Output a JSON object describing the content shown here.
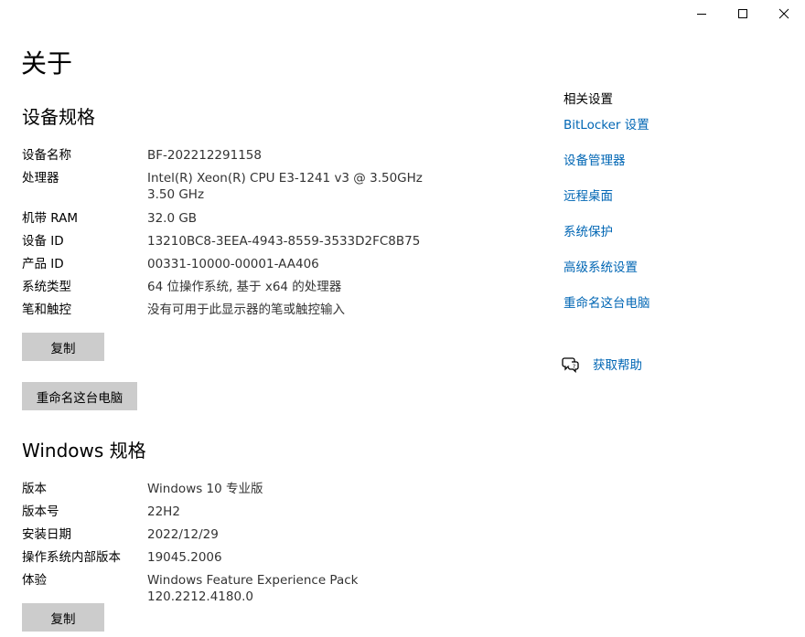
{
  "window": {
    "controls": {
      "minimize_icon": "minimize-icon",
      "maximize_icon": "maximize-icon",
      "close_icon": "close-icon"
    }
  },
  "page": {
    "title": "关于"
  },
  "device_specs": {
    "title": "设备规格",
    "rows": [
      {
        "label": "设备名称",
        "value": "BF-202212291158"
      },
      {
        "label": "处理器",
        "value": "Intel(R) Xeon(R) CPU E3-1241 v3 @ 3.50GHz   3.50 GHz"
      },
      {
        "label": "机带 RAM",
        "value": "32.0 GB"
      },
      {
        "label": "设备 ID",
        "value": "13210BC8-3EEA-4943-8559-3533D2FC8B75"
      },
      {
        "label": "产品 ID",
        "value": "00331-10000-00001-AA406"
      },
      {
        "label": "系统类型",
        "value": "64 位操作系统, 基于 x64 的处理器"
      },
      {
        "label": "笔和触控",
        "value": "没有可用于此显示器的笔或触控输入"
      }
    ],
    "copy_button": "复制",
    "rename_button": "重命名这台电脑"
  },
  "windows_specs": {
    "title": "Windows 规格",
    "rows": [
      {
        "label": "版本",
        "value": "Windows 10 专业版"
      },
      {
        "label": "版本号",
        "value": "22H2"
      },
      {
        "label": "安装日期",
        "value": "2022/12/29"
      },
      {
        "label": "操作系统内部版本",
        "value": "19045.2006"
      },
      {
        "label": "体验",
        "value": "Windows Feature Experience Pack 120.2212.4180.0"
      }
    ],
    "copy_button": "复制"
  },
  "related_settings": {
    "title": "相关设置",
    "links": [
      "BitLocker 设置",
      "设备管理器",
      "远程桌面",
      "系统保护",
      "高级系统设置",
      "重命名这台电脑"
    ]
  },
  "help": {
    "icon": "chat-help-icon",
    "label": "获取帮助"
  },
  "colors": {
    "link": "#0066b4",
    "button_bg": "#cccccc",
    "value_text": "#333333"
  }
}
